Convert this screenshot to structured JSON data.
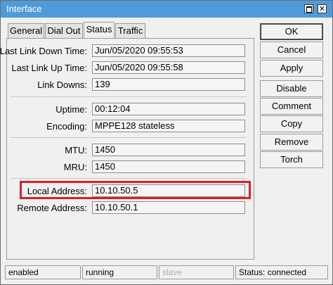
{
  "window": {
    "title": "Interface"
  },
  "tabs": [
    "General",
    "Dial Out",
    "Status",
    "Traffic"
  ],
  "fields": {
    "last_link_down_time": {
      "label": "Last Link Down Time:",
      "value": "Jun/05/2020 09:55:53"
    },
    "last_link_up_time": {
      "label": "Last Link Up Time:",
      "value": "Jun/05/2020 09:55:58"
    },
    "link_downs": {
      "label": "Link Downs:",
      "value": "139"
    },
    "uptime": {
      "label": "Uptime:",
      "value": "00:12:04"
    },
    "encoding": {
      "label": "Encoding:",
      "value": "MPPE128 stateless"
    },
    "mtu": {
      "label": "MTU:",
      "value": "1450"
    },
    "mru": {
      "label": "MRU:",
      "value": "1450"
    },
    "local_address": {
      "label": "Local Address:",
      "value": "10.10.50.5"
    },
    "remote_address": {
      "label": "Remote Address:",
      "value": "10.10.50.1"
    }
  },
  "buttons": [
    "OK",
    "Cancel",
    "Apply",
    "Disable",
    "Comment",
    "Copy",
    "Remove",
    "Torch"
  ],
  "status_bar": [
    "enabled",
    "running",
    "slave",
    "Status: connected"
  ],
  "colors": {
    "title_bar": "#4f9bd9",
    "highlight": "#d6202b"
  }
}
